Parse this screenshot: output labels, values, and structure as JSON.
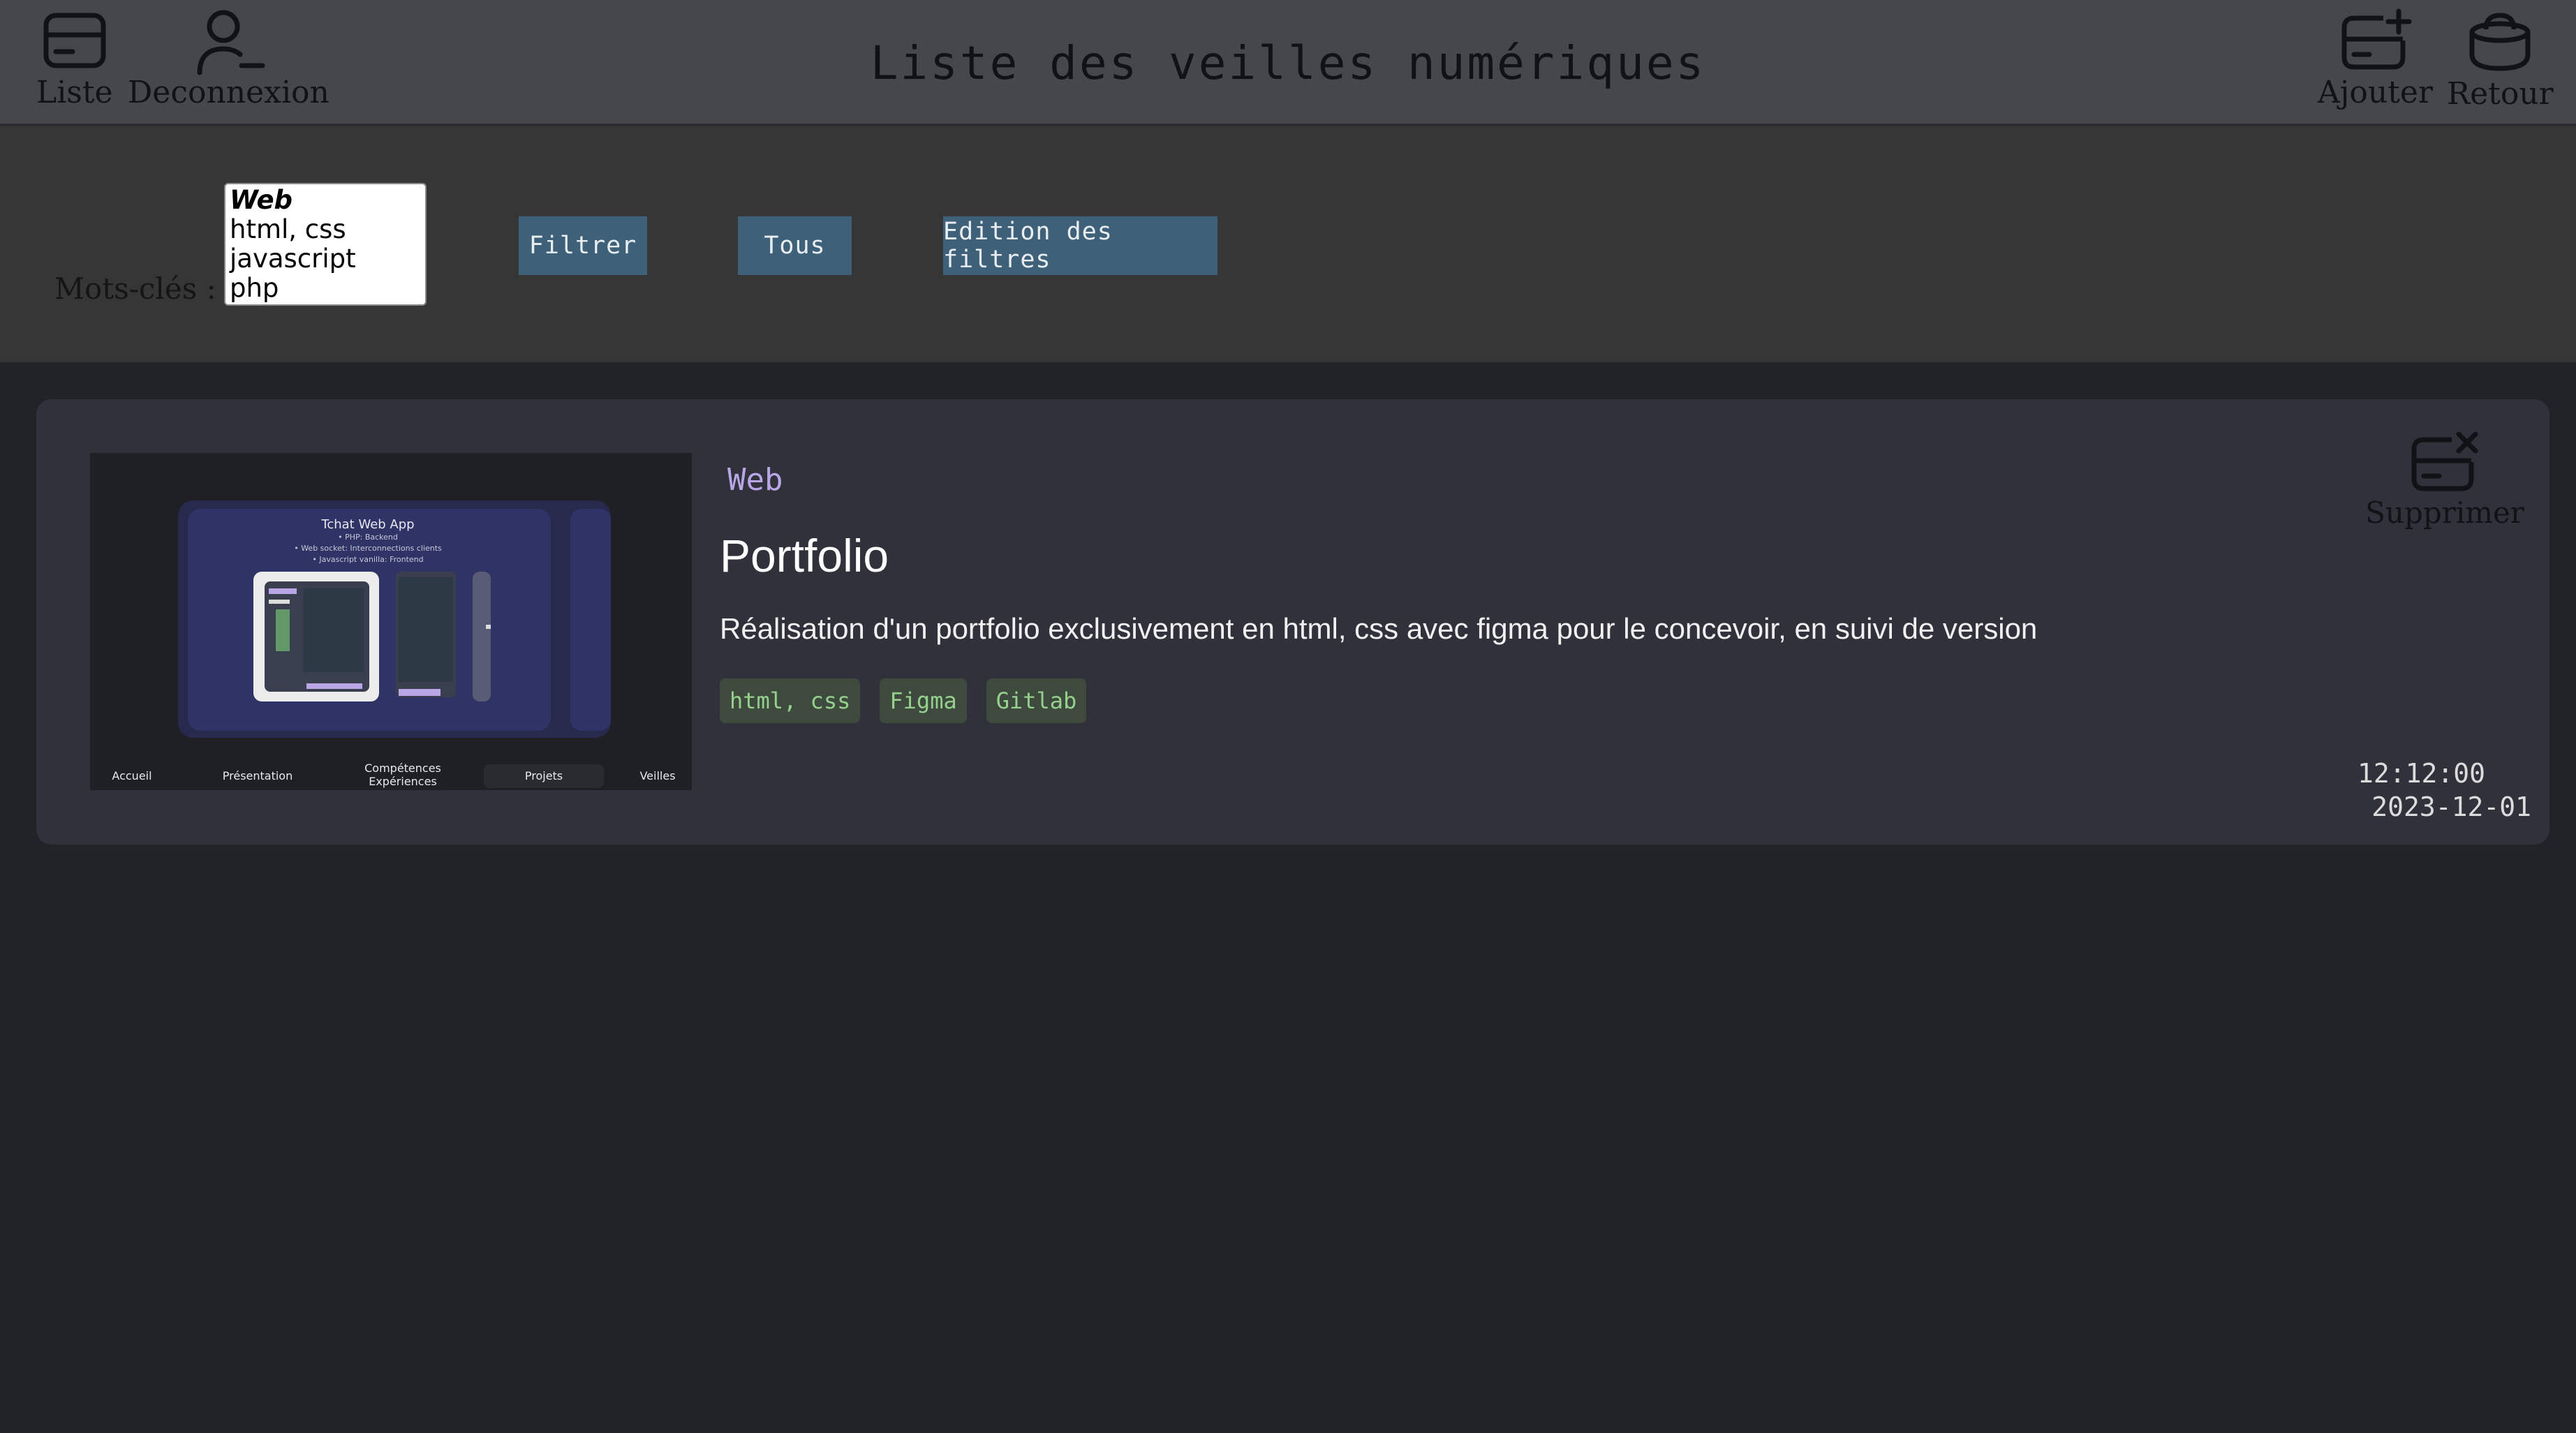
{
  "header": {
    "title": "Liste des veilles numériques",
    "left_buttons": [
      {
        "label": "Liste",
        "icon": "card-icon"
      },
      {
        "label": "Deconnexion",
        "icon": "user-minus-icon"
      }
    ],
    "right_buttons": [
      {
        "label": "Ajouter",
        "icon": "card-plus-icon"
      },
      {
        "label": "Retour",
        "icon": "basket-icon"
      }
    ]
  },
  "filters": {
    "keywords_label": "Mots-clés :",
    "keyword_options": [
      "Web",
      "html, css",
      "javascript",
      "php"
    ],
    "selected_option": "Web",
    "filter_button": "Filtrer",
    "all_button": "Tous",
    "edit_filters_button": "Edition des filtres"
  },
  "card": {
    "category": "Web",
    "title": "Portfolio",
    "description": "Réalisation d'un portfolio exclusivement en html, css avec figma pour le concevoir, en suivi de version",
    "tags": [
      "html, css",
      "Figma",
      "Gitlab"
    ],
    "delete_label": "Supprimer",
    "time": "12:12:00",
    "date": "2023-12-01",
    "thumbnail": {
      "heading": "Tchat Web App",
      "bullets": [
        "• PHP: Backend",
        "• Web socket: Interconnections clients",
        "• Javascript vanilla: Frontend"
      ],
      "nav": [
        "Accueil",
        "Présentation",
        "Compétences Expériences",
        "Projets",
        "Veilles"
      ]
    }
  },
  "colors": {
    "header_bg": "#46474c",
    "filter_bg": "#363637",
    "page_bg": "#222329",
    "card_bg": "#30313b",
    "button_bg": "#3f6079",
    "tag_bg": "#3e4a3e",
    "tag_text": "#95d18d",
    "category_text": "#b9a6e6"
  }
}
